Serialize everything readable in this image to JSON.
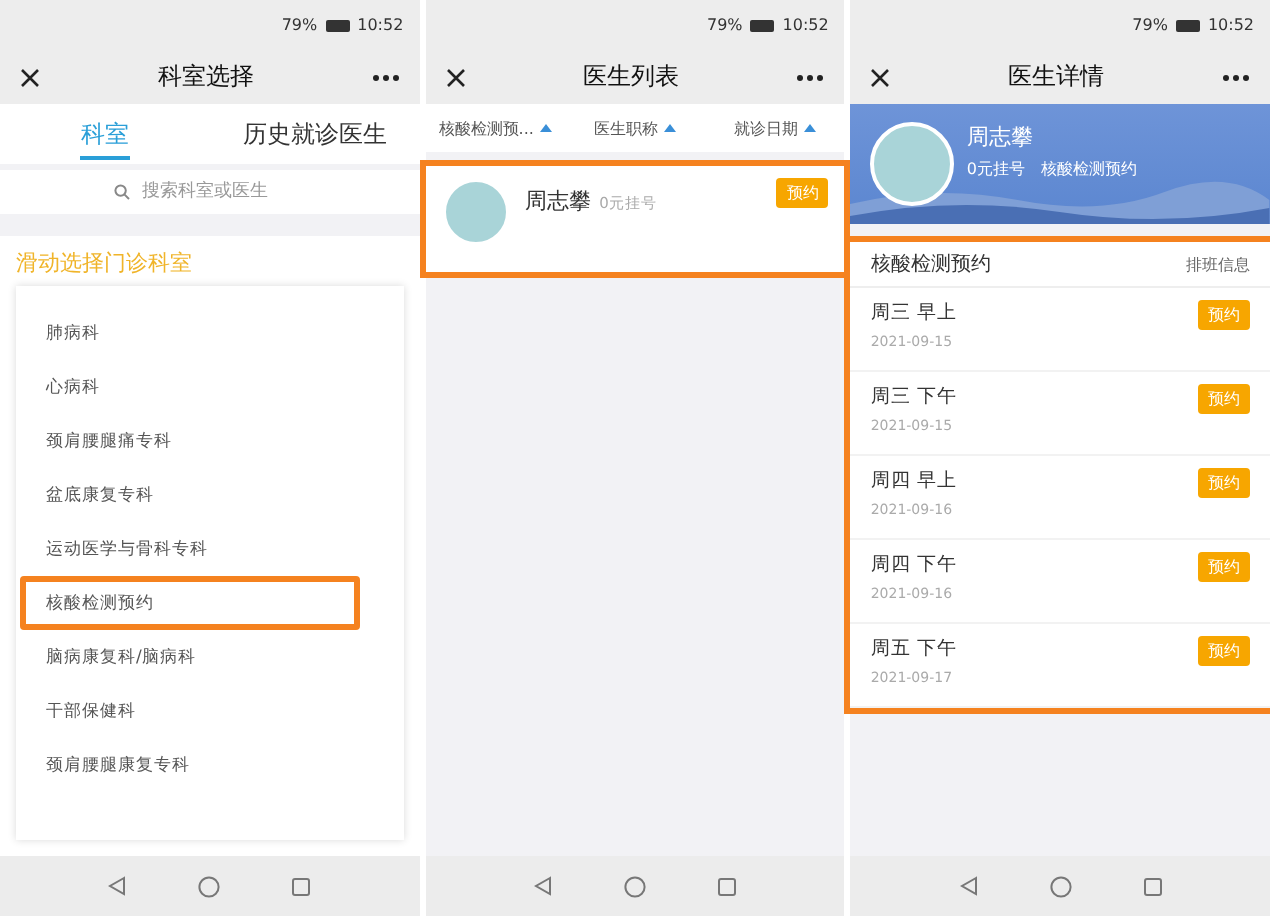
{
  "phones": [
    {
      "kind": "departments",
      "status": {
        "battery": "79%",
        "time": "10:52"
      },
      "title": "科室选择",
      "tabs": [
        {
          "label": "科室",
          "selected": true
        },
        {
          "label": "历史就诊医生",
          "selected": false
        }
      ],
      "search": {
        "placeholder": "搜索科室或医生"
      },
      "section_title": "滑动选择门诊科室",
      "departments": [
        {
          "name": "肺病科",
          "highlighted": false
        },
        {
          "name": "心病科",
          "highlighted": false
        },
        {
          "name": "颈肩腰腿痛专科",
          "highlighted": false
        },
        {
          "name": "盆底康复专科",
          "highlighted": false
        },
        {
          "name": "运动医学与骨科专科",
          "highlighted": false
        },
        {
          "name": "核酸检测预约",
          "highlighted": true
        },
        {
          "name": "脑病康复科/脑病科",
          "highlighted": false
        },
        {
          "name": "干部保健科",
          "highlighted": false
        },
        {
          "name": "颈肩腰腿康复专科",
          "highlighted": false
        }
      ]
    },
    {
      "kind": "doctor_list",
      "status": {
        "battery": "79%",
        "time": "10:52"
      },
      "title": "医生列表",
      "filters": [
        {
          "label": "核酸检测预..."
        },
        {
          "label": "医生职称"
        },
        {
          "label": "就诊日期"
        }
      ],
      "doctors": [
        {
          "name": "周志攀",
          "fee": "0元挂号",
          "button": "预约",
          "highlighted": true
        }
      ]
    },
    {
      "kind": "doctor_detail",
      "status": {
        "battery": "79%",
        "time": "10:52"
      },
      "title": "医生详情",
      "doctor": {
        "name": "周志攀",
        "fee": "0元挂号",
        "department": "核酸检测预约"
      },
      "schedule": {
        "title": "核酸检测预约",
        "link": "排班信息",
        "highlighted": true,
        "slots": [
          {
            "day": "周三 早上",
            "date": "2021-09-15",
            "button": "预约"
          },
          {
            "day": "周三 下午",
            "date": "2021-09-15",
            "button": "预约"
          },
          {
            "day": "周四 早上",
            "date": "2021-09-16",
            "button": "预约"
          },
          {
            "day": "周四 下午",
            "date": "2021-09-16",
            "button": "预约"
          },
          {
            "day": "周五 下午",
            "date": "2021-09-17",
            "button": "预约"
          }
        ]
      }
    }
  ]
}
